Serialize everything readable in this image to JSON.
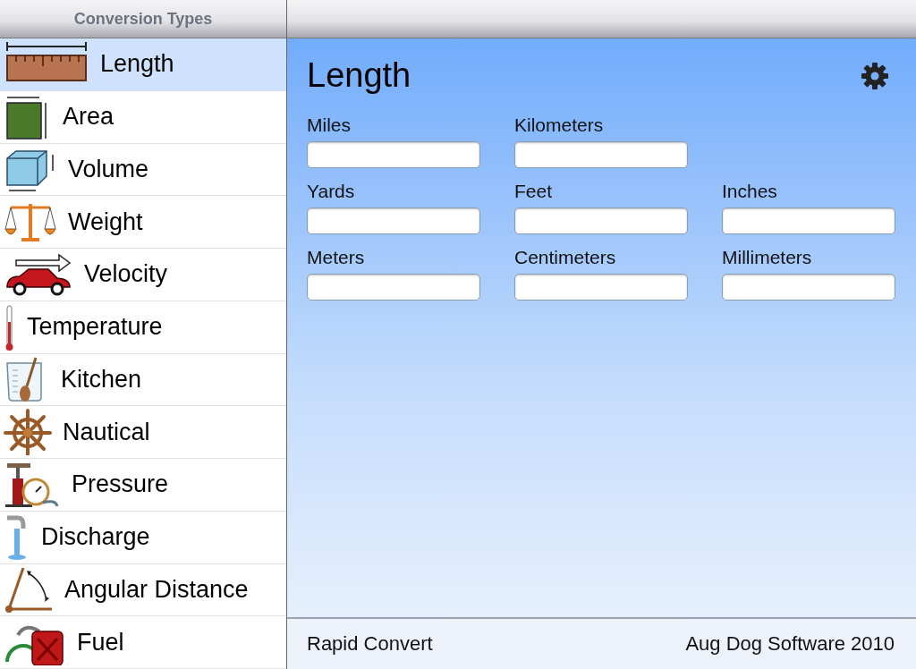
{
  "sidebar": {
    "title": "Conversion Types",
    "items": [
      {
        "label": "Length",
        "kind": "ruler",
        "selected": true
      },
      {
        "label": "Area",
        "kind": "square",
        "selected": false
      },
      {
        "label": "Volume",
        "kind": "cube",
        "selected": false
      },
      {
        "label": "Weight",
        "kind": "scale",
        "selected": false
      },
      {
        "label": "Velocity",
        "kind": "car",
        "selected": false
      },
      {
        "label": "Temperature",
        "kind": "thermometer",
        "selected": false
      },
      {
        "label": "Kitchen",
        "kind": "cup",
        "selected": false
      },
      {
        "label": "Nautical",
        "kind": "wheel",
        "selected": false
      },
      {
        "label": "Pressure",
        "kind": "pump",
        "selected": false
      },
      {
        "label": "Discharge",
        "kind": "faucet",
        "selected": false
      },
      {
        "label": "Angular Distance",
        "kind": "angle",
        "selected": false
      },
      {
        "label": "Fuel",
        "kind": "fuel",
        "selected": false
      }
    ]
  },
  "main": {
    "title": "Length",
    "rows": [
      {
        "fields": [
          {
            "label": "Miles"
          },
          {
            "label": "Kilometers"
          }
        ]
      },
      {
        "fields": [
          {
            "label": "Yards"
          },
          {
            "label": "Feet"
          },
          {
            "label": "Inches"
          }
        ]
      },
      {
        "fields": [
          {
            "label": "Meters"
          },
          {
            "label": "Centimeters"
          },
          {
            "label": "Millimeters"
          }
        ]
      }
    ]
  },
  "footer": {
    "left": "Rapid Convert",
    "right": "Aug Dog Software 2010"
  }
}
